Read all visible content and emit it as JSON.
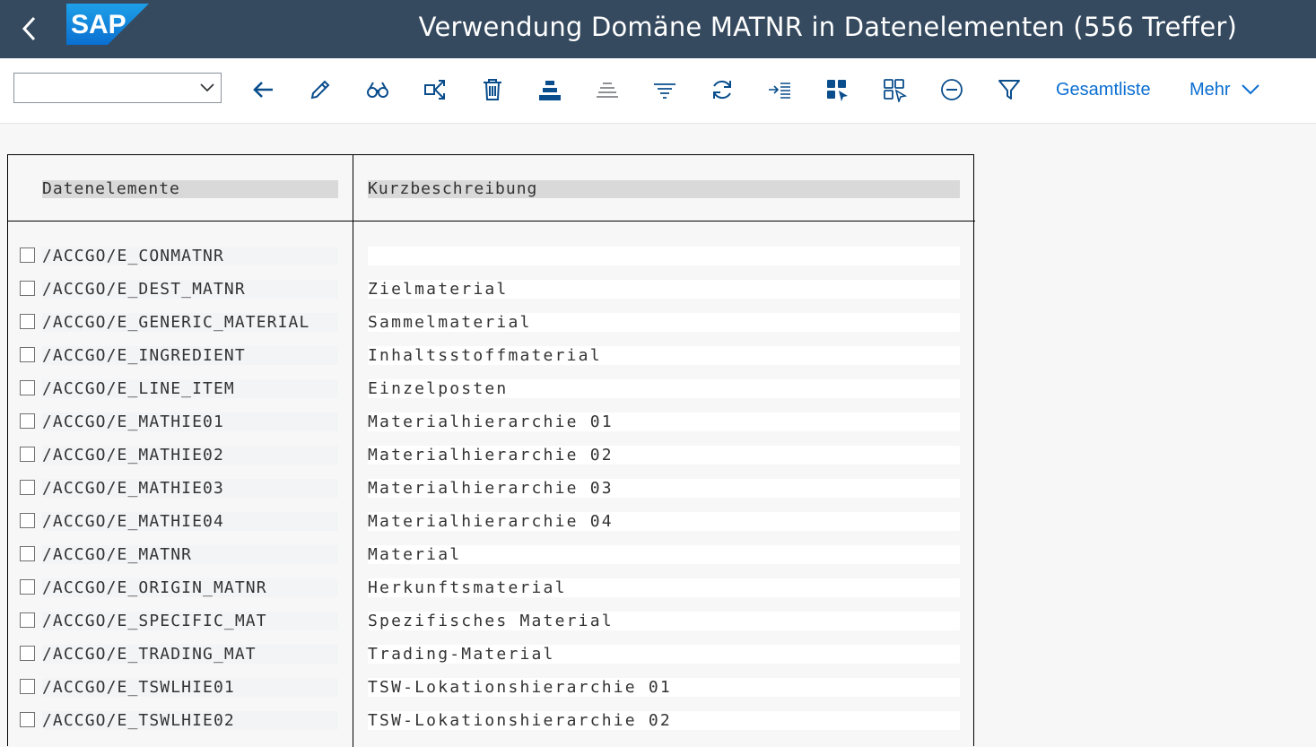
{
  "header": {
    "title": "Verwendung Domäne MATNR in Datenelementen (556 Treffer)",
    "logo_text": "SAP",
    "bg_color": "#354a5f"
  },
  "toolbar": {
    "combo_value": "",
    "icons": [
      "back-arrow-icon",
      "pencil-icon",
      "binoculars-icon",
      "share-icon",
      "delete-icon",
      "sort-ascending-icon",
      "sort-descending-icon",
      "filter-lines-icon",
      "refresh-icon",
      "indent-icon",
      "select-all-icon",
      "deselect-all-icon",
      "collapse-icon",
      "filter-icon"
    ],
    "gesamtliste_label": "Gesamtliste",
    "mehr_label": "Mehr"
  },
  "table": {
    "headers": [
      "Datenelemente",
      "Kurzbeschreibung"
    ],
    "rows": [
      {
        "name": "/ACCGO/E_CONMATNR",
        "desc": ""
      },
      {
        "name": "/ACCGO/E_DEST_MATNR",
        "desc": "Zielmaterial"
      },
      {
        "name": "/ACCGO/E_GENERIC_MATERIAL",
        "desc": "Sammelmaterial"
      },
      {
        "name": "/ACCGO/E_INGREDIENT",
        "desc": "Inhaltsstoffmaterial"
      },
      {
        "name": "/ACCGO/E_LINE_ITEM",
        "desc": "Einzelposten"
      },
      {
        "name": "/ACCGO/E_MATHIE01",
        "desc": "Materialhierarchie 01"
      },
      {
        "name": "/ACCGO/E_MATHIE02",
        "desc": "Materialhierarchie 02"
      },
      {
        "name": "/ACCGO/E_MATHIE03",
        "desc": "Materialhierarchie 03"
      },
      {
        "name": "/ACCGO/E_MATHIE04",
        "desc": "Materialhierarchie 04"
      },
      {
        "name": "/ACCGO/E_MATNR",
        "desc": "Material"
      },
      {
        "name": "/ACCGO/E_ORIGIN_MATNR",
        "desc": "Herkunftsmaterial"
      },
      {
        "name": "/ACCGO/E_SPECIFIC_MAT",
        "desc": "Spezifisches Material"
      },
      {
        "name": "/ACCGO/E_TRADING_MAT",
        "desc": "Trading-Material"
      },
      {
        "name": "/ACCGO/E_TSWLHIE01",
        "desc": "TSW-Lokationshierarchie 01"
      },
      {
        "name": "/ACCGO/E_TSWLHIE02",
        "desc": "TSW-Lokationshierarchie 02"
      }
    ]
  }
}
